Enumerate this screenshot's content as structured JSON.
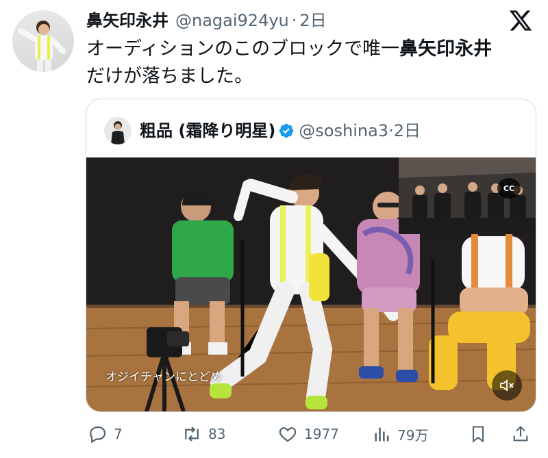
{
  "tweet": {
    "author_name": "鼻矢印永井",
    "author_handle": "@nagai924yu",
    "separator": "·",
    "time": "2日",
    "text_prefix": "オーディションのこのブロックで唯一",
    "text_bold": "鼻矢印永井",
    "text_suffix": "だけが落ちました。"
  },
  "quoted": {
    "author_name": "粗品 (霜降り明星)",
    "author_handle": "@soshina3",
    "separator": "·",
    "time": "2日",
    "video_caption": "オジイチャンにとどめ",
    "cc_label": "CC"
  },
  "actions": {
    "replies": "7",
    "retweets": "83",
    "likes": "1977",
    "views": "79万"
  },
  "icons": [
    "x-logo-icon",
    "verified-badge-icon",
    "reply-icon",
    "retweet-icon",
    "like-icon",
    "views-icon",
    "bookmark-icon",
    "share-icon",
    "mute-icon",
    "cc-icon"
  ],
  "colors": {
    "verified": "#1d9bf0",
    "secondary_text": "#536471",
    "border": "#cfd9de"
  }
}
